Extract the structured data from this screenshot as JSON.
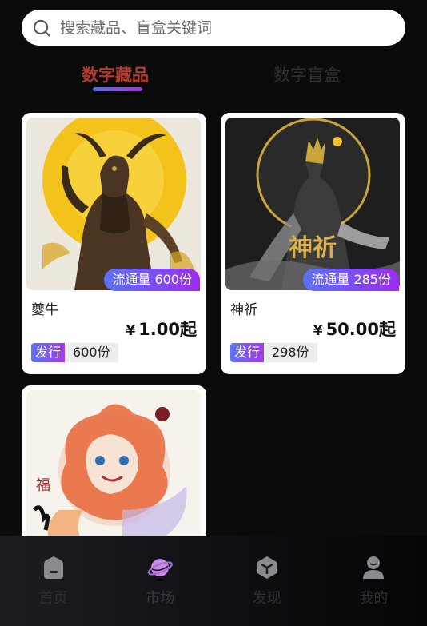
{
  "search": {
    "placeholder": "搜索藏品、盲盒关键词"
  },
  "tabs": {
    "active": "数字藏品",
    "inactive": "数字盲盒"
  },
  "cards": [
    {
      "name": "夔牛",
      "circulation": "流通量 600份",
      "yen": "¥",
      "price": "1.00起",
      "issue_label": "发行",
      "issue_qty": "600份"
    },
    {
      "name": "神祈",
      "circulation": "流通量 285份",
      "yen": "¥",
      "price": "50.00起",
      "issue_label": "发行",
      "issue_qty": "298份",
      "image_text": "神祈"
    },
    {
      "seal_text": "福"
    }
  ],
  "nav": [
    {
      "label": "首页",
      "icon": "home-icon"
    },
    {
      "label": "市场",
      "icon": "planet-icon"
    },
    {
      "label": "发现",
      "icon": "cube-icon"
    },
    {
      "label": "我的",
      "icon": "user-icon"
    }
  ],
  "colors": {
    "accent_start": "#4f6ef7",
    "accent_end": "#b02df2",
    "active_tab": "#b33a2c",
    "background": "#0b0b0c"
  }
}
